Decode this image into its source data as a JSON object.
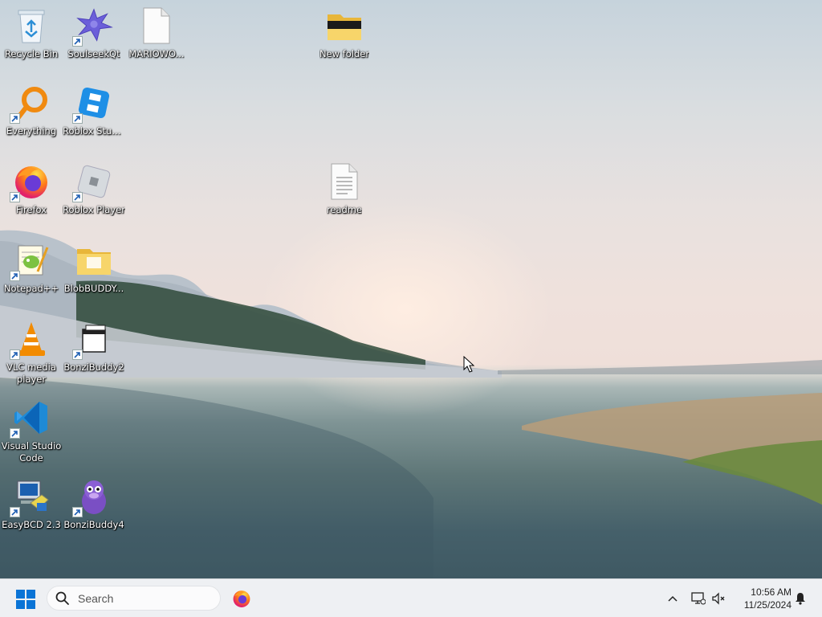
{
  "desktop": {
    "icons": [
      {
        "label": "Recycle Bin",
        "icon": "recycle-bin-icon"
      },
      {
        "label": "SoulseekQt",
        "icon": "soulseek-icon"
      },
      {
        "label": "MARIOWO...",
        "icon": "text-file-icon"
      },
      {
        "label": "New folder",
        "icon": "folder-icon"
      },
      {
        "label": "Everything",
        "icon": "everything-search-icon"
      },
      {
        "label": "Roblox Studio",
        "icon": "roblox-studio-icon"
      },
      {
        "label": "Firefox",
        "icon": "firefox-icon"
      },
      {
        "label": "Roblox Player",
        "icon": "roblox-player-icon"
      },
      {
        "label": "readme",
        "icon": "text-file-icon"
      },
      {
        "label": "Notepad++",
        "icon": "notepad-plus-plus-icon"
      },
      {
        "label": "BlobBUDDY...",
        "icon": "folder-icon"
      },
      {
        "label": "VLC media player",
        "icon": "vlc-icon"
      },
      {
        "label": "BonziBuddy2",
        "icon": "window-app-icon"
      },
      {
        "label": "Visual Studio Code",
        "icon": "vscode-icon"
      },
      {
        "label": "EasyBCD 2.3",
        "icon": "easybcd-icon"
      },
      {
        "label": "BonziBuddy4",
        "icon": "bonzibuddy-icon"
      }
    ]
  },
  "taskbar": {
    "search_placeholder": "Search",
    "clock_time": "10:56 AM",
    "clock_date": "11/25/2024",
    "pinned": [
      "firefox-icon"
    ],
    "tray_icons": [
      "chevron-up-icon",
      "network-icon",
      "volume-muted-icon",
      "notification-bell-icon"
    ]
  },
  "colors": {
    "taskbar_bg": "#eef0f3",
    "windows_blue": "#0a74d6"
  }
}
